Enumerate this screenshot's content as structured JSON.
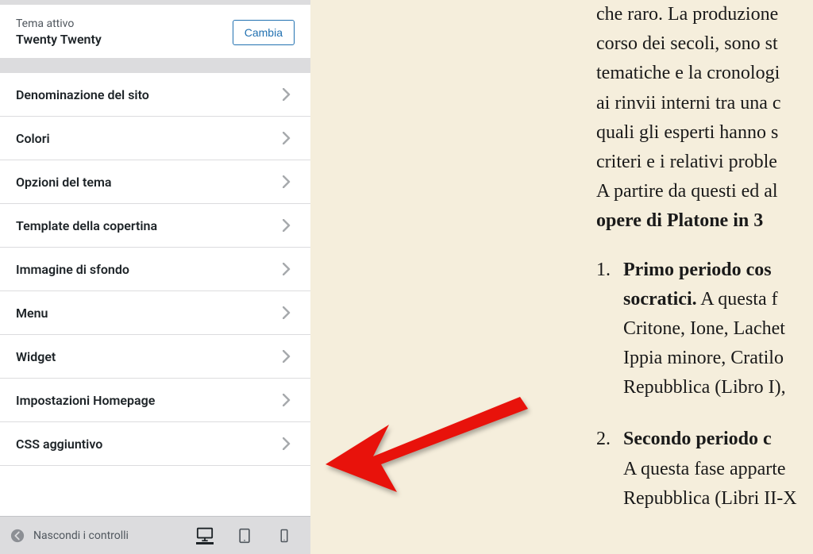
{
  "theme": {
    "label": "Tema attivo",
    "name": "Twenty Twenty",
    "change_button": "Cambia"
  },
  "menu_items": [
    {
      "label": "Denominazione del sito"
    },
    {
      "label": "Colori"
    },
    {
      "label": "Opzioni del tema"
    },
    {
      "label": "Template della copertina"
    },
    {
      "label": "Immagine di sfondo"
    },
    {
      "label": "Menu"
    },
    {
      "label": "Widget"
    },
    {
      "label": "Impostazioni Homepage"
    },
    {
      "label": "CSS aggiuntivo"
    }
  ],
  "bottom_bar": {
    "hide_label": "Nascondi i controlli"
  },
  "preview": {
    "para_line1": "che raro. La produzione",
    "para_line2": "corso dei secoli, sono st",
    "para_line3": "tematiche e la cronologi",
    "para_line4": "ai rinvii interni tra una c",
    "para_line5": "quali gli esperti hanno s",
    "para_line6": "criteri e i relativi proble",
    "para_line7": "A partire da questi ed al",
    "para_bold": "opere di Platone in 3",
    "item1_bold_a": "Primo periodo cos",
    "item1_bold_b": "socratici.",
    "item1_text_a": " A questa f",
    "item1_text_b": "Critone, Ione, Lachet",
    "item1_text_c": "Ippia minore, Cratilo",
    "item1_text_d": "Repubblica (Libro I),",
    "item2_bold": "Secondo periodo c",
    "item2_text_a": "A questa fase apparte",
    "item2_text_b": "Repubblica (Libri II-X"
  }
}
